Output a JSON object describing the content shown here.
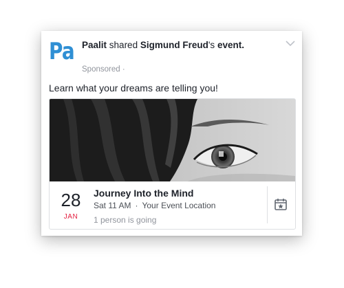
{
  "post": {
    "logo_text": "Pa",
    "page_name": "Paalit",
    "action_text": "shared",
    "host_name": "Sigmund Freud",
    "host_suffix": "'s",
    "object_text": "event.",
    "sponsored_label": "Sponsored",
    "sponsored_sep": "·",
    "message": "Learn what your dreams are telling you!"
  },
  "event": {
    "day": "28",
    "month": "JAN",
    "title": "Journey Into the Mind",
    "time": "Sat 11 AM",
    "separator": "·",
    "location": "Your Event Location",
    "going": "1 person is going"
  },
  "icons": {
    "menu": "chevron-down-icon",
    "save": "calendar-star-icon",
    "cover": "eye-photo"
  },
  "colors": {
    "brand": "#2f8fd4",
    "date_month": "#e41e3f",
    "secondary_text": "#90949c"
  }
}
